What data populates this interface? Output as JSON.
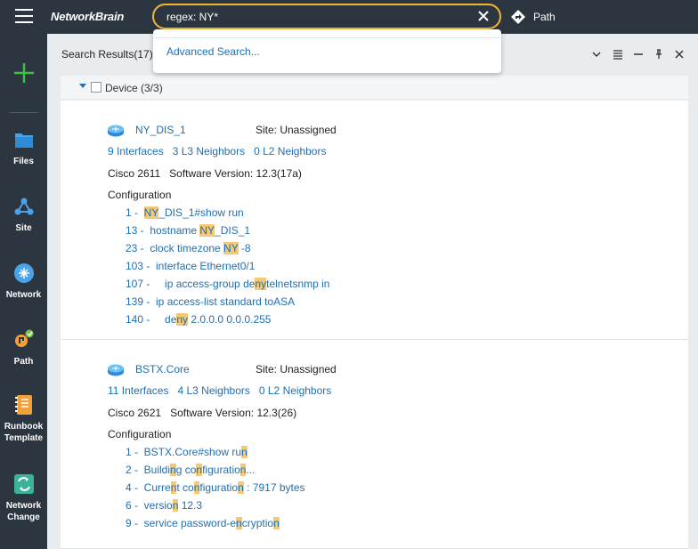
{
  "app": {
    "logo": "NetworkBrain"
  },
  "search": {
    "value": "regex: NY*",
    "advanced_label": "Advanced Search..."
  },
  "path_label": "Path",
  "sidebar": {
    "items": [
      {
        "label": "Files",
        "icon": "folder-icon"
      },
      {
        "label": "Site",
        "icon": "site-icon"
      },
      {
        "label": "Network",
        "icon": "network-icon"
      },
      {
        "label": "Path",
        "icon": "path-icon"
      },
      {
        "label": "Runbook Template",
        "icon": "runbook-icon"
      },
      {
        "label": "Network Change",
        "icon": "network-change-icon"
      }
    ]
  },
  "panel": {
    "title": "Search Results(17)",
    "group_label": "Device (3/3)"
  },
  "devices": [
    {
      "name": "NY_DIS_1",
      "site": "Site: Unassigned",
      "links": [
        "9 Interfaces",
        "3 L3 Neighbors",
        "0 L2 Neighbors"
      ],
      "vendor": "Cisco",
      "model": "2611",
      "software": "Software Version: 12.3(17a)",
      "config_title": "Configuration",
      "config_lines": [
        {
          "parts": [
            "1 -  ",
            "NY",
            "_DIS_1#show run"
          ]
        },
        {
          "parts": [
            "13 -  hostname ",
            "NY",
            "_DIS_1"
          ]
        },
        {
          "parts": [
            "23 -  clock timezone ",
            "NY",
            " -8"
          ]
        },
        {
          "parts": [
            "103 -  interface Ethernet0/1"
          ]
        },
        {
          "parts": [
            "107 -     ip access-group de",
            "ny",
            "telnetsnmp in"
          ]
        },
        {
          "parts": [
            "139 -  ip access-list standard toASA"
          ]
        },
        {
          "parts": [
            "140 -     de",
            "ny",
            " 2.0.0.0 0.0.0.255"
          ]
        }
      ]
    },
    {
      "name": "BSTX.Core",
      "site": "Site: Unassigned",
      "links": [
        "11 Interfaces",
        "4 L3 Neighbors",
        "0 L2 Neighbors"
      ],
      "vendor": "Cisco",
      "model": "2621",
      "software": "Software Version: 12.3(26)",
      "config_title": "Configuration",
      "config_lines": [
        {
          "parts": [
            "1 -  BSTX.Core#show ru",
            "n"
          ]
        },
        {
          "parts": [
            "2 -  Buildi",
            "n",
            "g co",
            "n",
            "figuratio",
            "n",
            "..."
          ]
        },
        {
          "parts": [
            "4 -  Curre",
            "n",
            "t co",
            "n",
            "figuratio",
            "n",
            " : 7917 bytes"
          ]
        },
        {
          "parts": [
            "6 -  versio",
            "n",
            " 12.3"
          ]
        },
        {
          "parts": [
            "9 -  service password-e",
            "n",
            "cryptio",
            "n"
          ]
        }
      ]
    }
  ],
  "colors": {
    "accent": "#f2b632",
    "link": "#1f6fb2",
    "topbar": "#2c3641",
    "highlight": "#f5c876"
  }
}
